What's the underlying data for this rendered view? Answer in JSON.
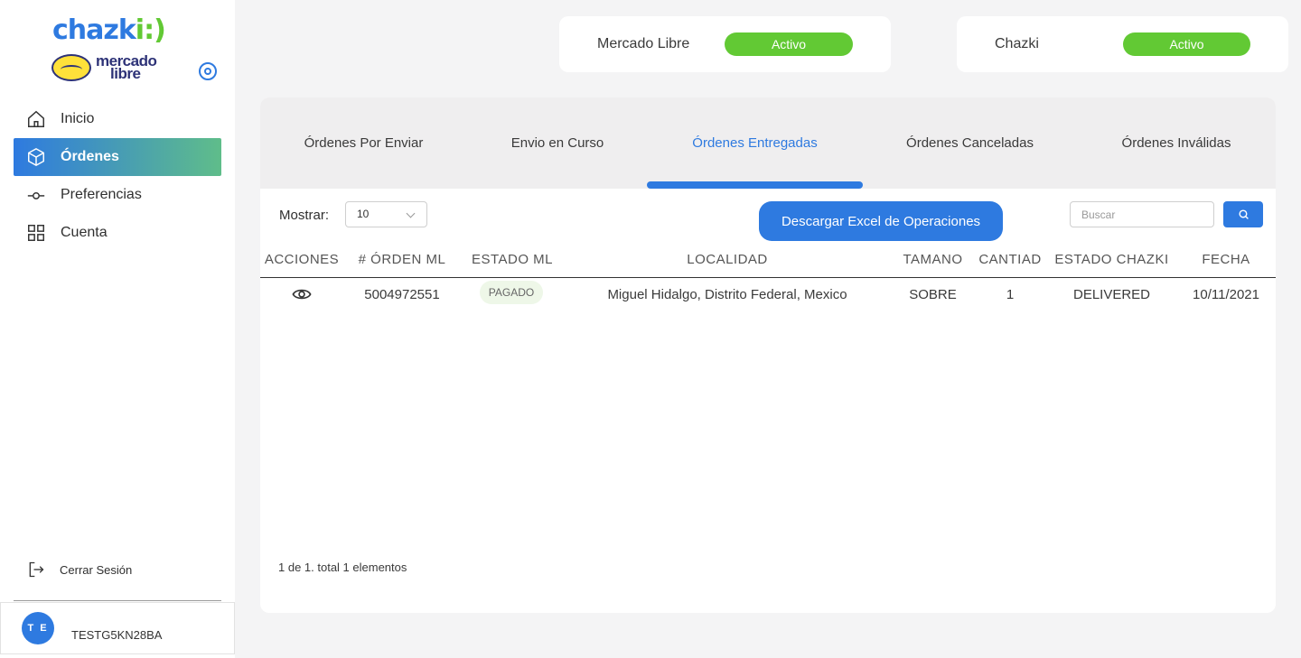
{
  "brand": {
    "name_main": "chazk",
    "name_accent": "i",
    "name_suffix": ":)",
    "partner_line1": "mercado",
    "partner_line2": "libre"
  },
  "sidebar": {
    "items": [
      {
        "label": "Inicio",
        "icon": "home-icon",
        "active": false
      },
      {
        "label": "Órdenes",
        "icon": "box-icon",
        "active": true
      },
      {
        "label": "Preferencias",
        "icon": "preferences-icon",
        "active": false
      },
      {
        "label": "Cuenta",
        "icon": "grid-icon",
        "active": false
      }
    ],
    "logout_label": "Cerrar Sesión"
  },
  "user": {
    "initials": "T E",
    "name": "TESTG5KN28BA"
  },
  "integrations": [
    {
      "name": "Mercado Libre",
      "status": "Activo"
    },
    {
      "name": "Chazki",
      "status": "Activo"
    }
  ],
  "tabs": [
    {
      "label": "Órdenes Por Enviar",
      "active": false
    },
    {
      "label": "Envio en Curso",
      "active": false
    },
    {
      "label": "Órdenes Entregadas",
      "active": true
    },
    {
      "label": "Órdenes Canceladas",
      "active": false
    },
    {
      "label": "Órdenes Inválidas",
      "active": false
    }
  ],
  "toolbar": {
    "show_label": "Mostrar:",
    "page_size": "10",
    "excel_button": "Descargar Excel de Operaciones",
    "search_placeholder": "Buscar"
  },
  "table": {
    "headers": [
      "ACCIONES",
      "# ÓRDEN ML",
      "ESTADO ML",
      "LOCALIDAD",
      "TAMANO",
      "CANTIAD",
      "ESTADO CHAZKI",
      "FECHA"
    ],
    "rows": [
      {
        "order": "5004972551",
        "status_ml": "PAGADO",
        "locality": "Miguel Hidalgo, Distrito Federal, Mexico",
        "size": "SOBRE",
        "quantity": "1",
        "status_chazki": "DELIVERED",
        "date": "10/11/2021"
      }
    ]
  },
  "pagination": "1 de 1. total 1 elementos",
  "colors": {
    "primary": "#2e7ae0",
    "success": "#62c934",
    "gradient_end": "#5fbd8a"
  }
}
